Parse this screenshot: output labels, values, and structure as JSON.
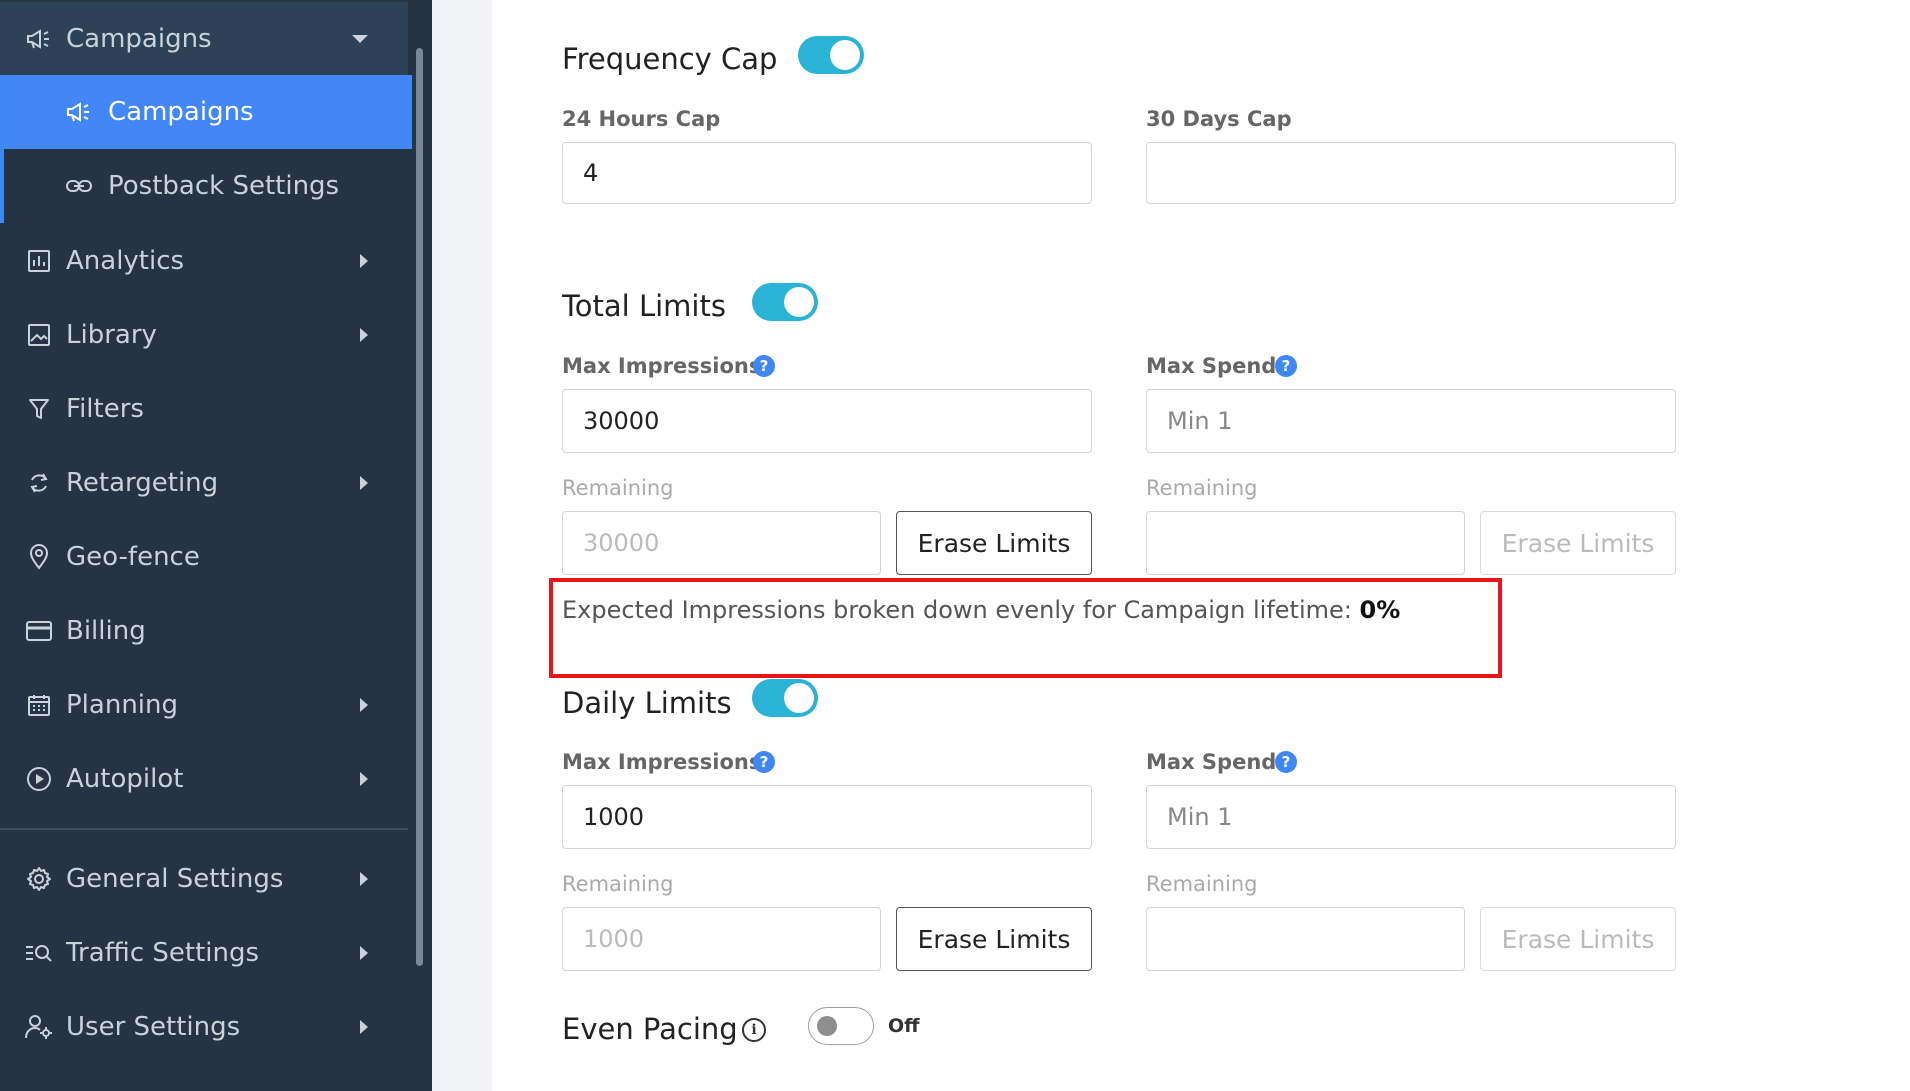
{
  "sidebar": {
    "header": {
      "label": "Campaigns",
      "icon": "megaphone-icon"
    },
    "sub_items": [
      {
        "label": "Campaigns",
        "icon": "megaphone-icon",
        "active": true
      },
      {
        "label": "Postback Settings",
        "icon": "link-icon",
        "active": false
      }
    ],
    "items": [
      {
        "label": "Analytics",
        "icon": "bar-chart-icon",
        "has_submenu": true
      },
      {
        "label": "Library",
        "icon": "image-icon",
        "has_submenu": true
      },
      {
        "label": "Filters",
        "icon": "filter-icon",
        "has_submenu": false
      },
      {
        "label": "Retargeting",
        "icon": "refresh-icon",
        "has_submenu": true
      },
      {
        "label": "Geo-fence",
        "icon": "map-pin-icon",
        "has_submenu": false
      },
      {
        "label": "Billing",
        "icon": "credit-card-icon",
        "has_submenu": false
      },
      {
        "label": "Planning",
        "icon": "calendar-icon",
        "has_submenu": true
      },
      {
        "label": "Autopilot",
        "icon": "play-circle-icon",
        "has_submenu": true
      }
    ],
    "settings_items": [
      {
        "label": "General Settings",
        "icon": "gear-icon",
        "has_submenu": true
      },
      {
        "label": "Traffic Settings",
        "icon": "list-search-icon",
        "has_submenu": true
      },
      {
        "label": "User Settings",
        "icon": "user-gear-icon",
        "has_submenu": true
      }
    ]
  },
  "frequency_cap": {
    "title": "Frequency Cap",
    "enabled": true,
    "hours24": {
      "label": "24 Hours Cap",
      "value": "4"
    },
    "days30": {
      "label": "30 Days Cap",
      "value": ""
    }
  },
  "total_limits": {
    "title": "Total Limits",
    "enabled": true,
    "max_impressions": {
      "label": "Max Impressions",
      "value": "30000"
    },
    "max_spend": {
      "label": "Max Spend",
      "placeholder": "Min 1"
    },
    "remaining_label": "Remaining",
    "remaining_impressions": "30000",
    "remaining_spend": "",
    "erase_label": "Erase Limits"
  },
  "expected": {
    "text": "Expected Impressions broken down evenly for Campaign lifetime:",
    "value": "0%"
  },
  "daily_limits": {
    "title": "Daily Limits",
    "enabled": true,
    "max_impressions": {
      "label": "Max Impressions",
      "value": "1000"
    },
    "max_spend": {
      "label": "Max Spend",
      "placeholder": "Min 1"
    },
    "remaining_label": "Remaining",
    "remaining_impressions": "1000",
    "remaining_spend": "",
    "erase_label": "Erase Limits"
  },
  "even_pacing": {
    "title": "Even Pacing",
    "enabled": false,
    "state_label": "Off",
    "info_glyph": "i"
  },
  "help_glyph": "?",
  "colors": {
    "sidebar_bg": "#253342",
    "active_item": "#4287f5",
    "toggle_on": "#2bb3d6",
    "highlight": "#e8141b",
    "help": "#3f87f5"
  }
}
